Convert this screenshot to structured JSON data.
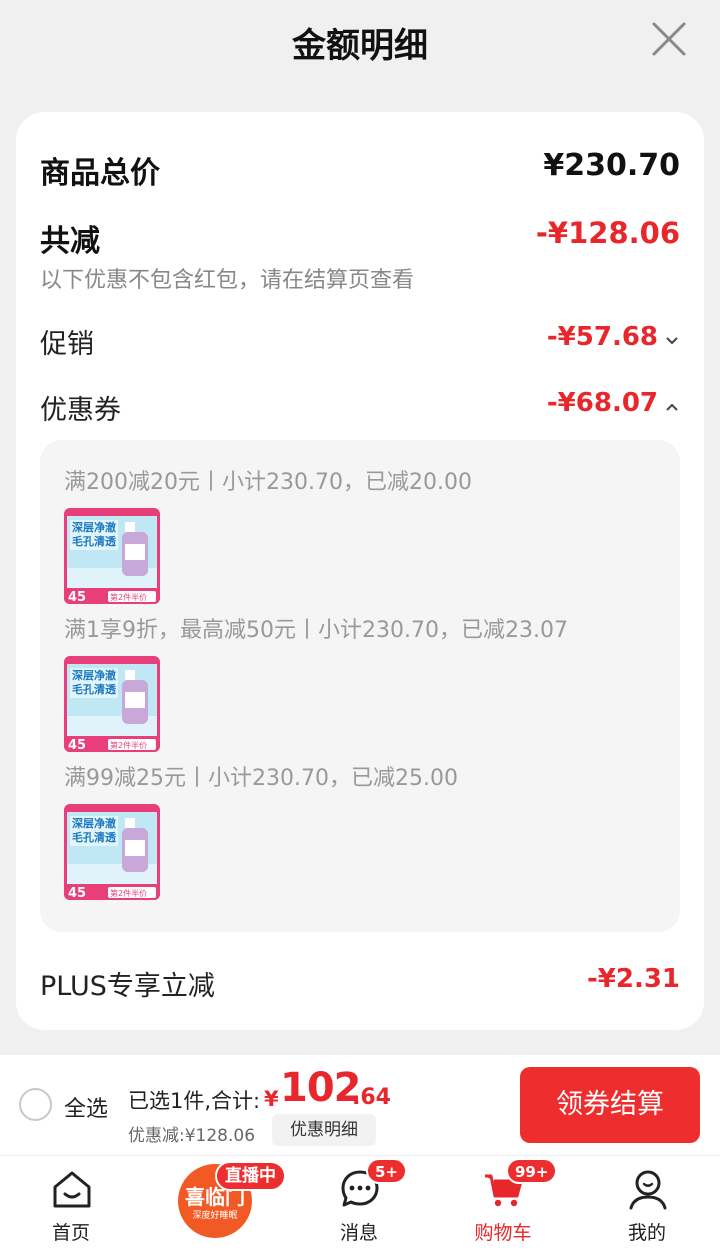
{
  "header": {
    "title": "金额明细",
    "close_icon": "close-icon"
  },
  "summary": {
    "total_label": "商品总价",
    "total_value": "¥230.70",
    "reduce_label": "共减",
    "reduce_value": "-¥128.06",
    "reduce_note": "以下优惠不包含红包，请在结算页查看",
    "promo_label": "促销",
    "promo_value": "-¥57.68",
    "coupon_label": "优惠券",
    "coupon_value": "-¥68.07",
    "plus_label": "PLUS专享立减",
    "plus_value": "-¥2.31"
  },
  "coupons": [
    {
      "text": "满200减20元丨小计230.70，已减20.00"
    },
    {
      "text": "满1享9折，最高减50元丨小计230.70，已减23.07"
    },
    {
      "text": "满99减25元丨小计230.70，已减25.00"
    }
  ],
  "product_thumb": {
    "headline": "深层净澈毛孔清透",
    "price_tag": "45",
    "promo": "第2件半价"
  },
  "bottom_bar": {
    "select_all": "全选",
    "selected_text": "已选1件,合计:",
    "price_symbol": "¥",
    "price_integer": "102",
    "price_decimal": ".64",
    "discount_text": "优惠减:¥128.06",
    "detail_button": "优惠明细",
    "checkout_button": "领券结算"
  },
  "tabs": [
    {
      "label": "首页",
      "icon": "home-icon"
    },
    {
      "label": "",
      "icon": "live-icon",
      "badge": "直播中",
      "logo_text": "喜临门",
      "logo_sub": "深度好睡眠"
    },
    {
      "label": "消息",
      "icon": "message-icon",
      "badge": "5+"
    },
    {
      "label": "购物车",
      "icon": "cart-icon",
      "badge": "99+",
      "active": true
    },
    {
      "label": "我的",
      "icon": "profile-icon"
    }
  ],
  "colors": {
    "accent_red": "#e8272c",
    "checkout_red": "#ee2d2f",
    "background": "#f0f0f0"
  }
}
